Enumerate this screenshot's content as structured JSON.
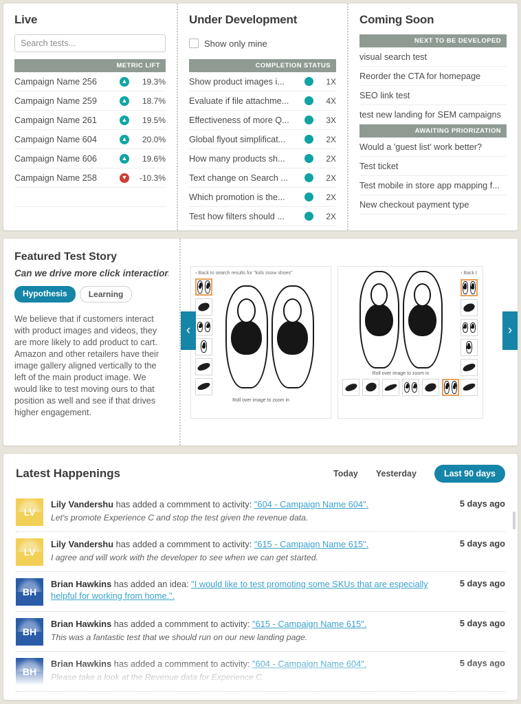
{
  "colors": {
    "accent_teal": "#1585a8",
    "section_bar": "#8f9a93",
    "status_up": "#10a5a5",
    "status_down": "#cf3b36",
    "link": "#3ba2cc",
    "page_bg": "#e7e4db",
    "avatar_yellow": "#f2cf56",
    "avatar_blue": "#2a5ca8",
    "thumb_selected": "#e8a05a"
  },
  "live": {
    "title": "Live",
    "search_placeholder": "Search tests...",
    "search_value": "",
    "column_header": "METRIC LIFT",
    "rows": [
      {
        "name": "Campaign Name 256",
        "direction": "up",
        "value": "19.3%"
      },
      {
        "name": "Campaign Name 259",
        "direction": "up",
        "value": "18.7%"
      },
      {
        "name": "Campaign Name 261",
        "direction": "up",
        "value": "19.5%"
      },
      {
        "name": "Campaign Name 604",
        "direction": "up",
        "value": "20.0%"
      },
      {
        "name": "Campaign Name 606",
        "direction": "up",
        "value": "19.6%"
      },
      {
        "name": "Campaign Name 258",
        "direction": "down",
        "value": "-10.3%"
      }
    ]
  },
  "under_development": {
    "title": "Under Development",
    "checkbox_label": "Show only mine",
    "checkbox_checked": false,
    "column_header": "COMPLETION STATUS",
    "rows": [
      {
        "name": "Show product images i...",
        "value": "1X"
      },
      {
        "name": "Evaluate if file attachme...",
        "value": "4X"
      },
      {
        "name": "Effectiveness of more Q...",
        "value": "3X"
      },
      {
        "name": "Global flyout simplificat...",
        "value": "2X"
      },
      {
        "name": "How many products sh...",
        "value": "2X"
      },
      {
        "name": "Text change on Search ...",
        "value": "2X"
      },
      {
        "name": "Which promotion is the...",
        "value": "2X"
      },
      {
        "name": "Test how filters should ...",
        "value": "2X"
      }
    ]
  },
  "coming_soon": {
    "title": "Coming Soon",
    "groups": [
      {
        "header": "NEXT TO BE DEVELOPED",
        "items": [
          "visual search test",
          "Reorder the CTA for homepage",
          "SEO link test",
          "test new landing for SEM campaigns"
        ]
      },
      {
        "header": "AWAITING PRIORIZATION",
        "items": [
          "Would a 'guest list' work better?",
          "Test ticket",
          "Test mobile in store app mapping f...",
          "New checkout payment type"
        ]
      }
    ]
  },
  "featured": {
    "title": "Featured Test Story",
    "subtitle": "Can we drive more click interaction...",
    "tabs": [
      {
        "label": "Hypothesis",
        "active": true
      },
      {
        "label": "Learning",
        "active": false
      }
    ],
    "body": "We believe that if customers interact with product images and videos, they are more likely to add product to cart. Amazon and other retailers have their image gallery aligned vertically to the left of the main product image. We would like to test moving ours to that position as well and see if that drives higher engagement.",
    "prev_arrow": "‹",
    "next_arrow": "›",
    "shots": [
      {
        "back_label": "‹ Back to search results for \"kids snow shoes\"",
        "caption": "Roll over image to zoom in"
      },
      {
        "back_label": "‹ Back t",
        "caption": "Roll over image to zoom in"
      }
    ]
  },
  "happenings": {
    "title": "Latest Happenings",
    "filters": [
      {
        "label": "Today",
        "active": false
      },
      {
        "label": "Yesterday",
        "active": false
      },
      {
        "label": "Last 90 days",
        "active": true
      }
    ],
    "rows": [
      {
        "initials": "LV",
        "avatar": "yellow",
        "author": "Lily Vandershu",
        "action": " has added a commment to activity: ",
        "link": "\"604 - Campaign Name 604\".",
        "comment": "Let's promote Experience C and stop the test given the revenue data.",
        "time": "5 days ago"
      },
      {
        "initials": "LV",
        "avatar": "yellow",
        "author": "Lily Vandershu",
        "action": " has added a commment to activity: ",
        "link": "\"615 - Campaign Name 615\".",
        "comment": "I agree and will work with the developer to see when we can get started.",
        "time": "5 days ago"
      },
      {
        "initials": "BH",
        "avatar": "blue",
        "author": "Brian Hawkins",
        "action": " has added an idea: ",
        "link": "\"I would like to test promoting some SKUs that are especially helpful for working from home.\".",
        "comment": "",
        "time": "5 days ago"
      },
      {
        "initials": "BH",
        "avatar": "blue",
        "author": "Brian Hawkins",
        "action": " has added a commment to activity: ",
        "link": "\"615 - Campaign Name 615\".",
        "comment": "This was a fantastic test that we should run on our new landing page.",
        "time": "5 days ago"
      },
      {
        "initials": "BH",
        "avatar": "blue",
        "author": "Brian Hawkins",
        "action": " has added a commment to activity: ",
        "link": "\"604 - Campaign Name 604\".",
        "comment": "Please take a look at the Revenue data for Experience C.",
        "time": "5 days ago"
      }
    ]
  }
}
